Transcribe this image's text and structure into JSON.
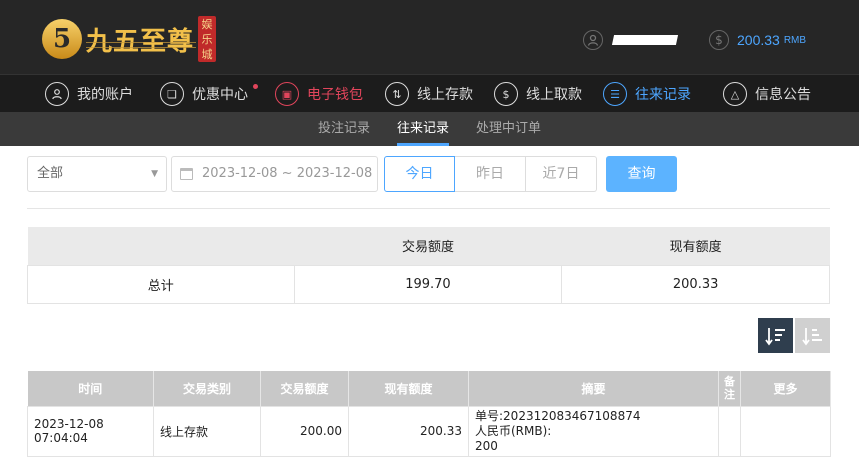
{
  "header": {
    "logo_mark": "5",
    "logo_text": "九五至尊",
    "logo_badge": [
      "娱",
      "乐",
      "城"
    ],
    "balance": "200.33",
    "balance_unit": "RMB"
  },
  "nav": {
    "items": [
      {
        "label": "我的账户",
        "icon": "user-icon"
      },
      {
        "label": "优惠中心",
        "icon": "gift-icon"
      },
      {
        "label": "电子钱包",
        "icon": "wallet-icon"
      },
      {
        "label": "线上存款",
        "icon": "deposit-icon"
      },
      {
        "label": "线上取款",
        "icon": "withdraw-icon"
      },
      {
        "label": "往来记录",
        "icon": "records-icon"
      },
      {
        "label": "信息公告",
        "icon": "bell-icon"
      }
    ]
  },
  "subnav": {
    "items": [
      "投注记录",
      "往来记录",
      "处理中订单"
    ]
  },
  "filters": {
    "type_select": "全部",
    "date_range": "2023-12-08 ~ 2023-12-08",
    "segments": [
      "今日",
      "昨日",
      "近7日"
    ],
    "query_label": "查询"
  },
  "summary": {
    "headers": [
      "",
      "交易额度",
      "现有额度"
    ],
    "row": [
      "总计",
      "199.70",
      "200.33"
    ]
  },
  "records": {
    "headers": [
      "时间",
      "交易类别",
      "交易额度",
      "现有额度",
      "摘要",
      "备注",
      "更多"
    ],
    "rows": [
      {
        "time": "2023-12-08 07:04:04",
        "category": "线上存款",
        "amount": "200.00",
        "balance": "200.33",
        "summary_line1": "单号:202312083467108874",
        "summary_line2": "人民币(RMB):",
        "summary_line3": "200",
        "note": "",
        "more": ""
      }
    ]
  },
  "colors": {
    "accent_blue": "#4da6ff",
    "accent_red": "#e0455b",
    "header_bg": "#262626",
    "logo_gold": "#f2c04a"
  }
}
